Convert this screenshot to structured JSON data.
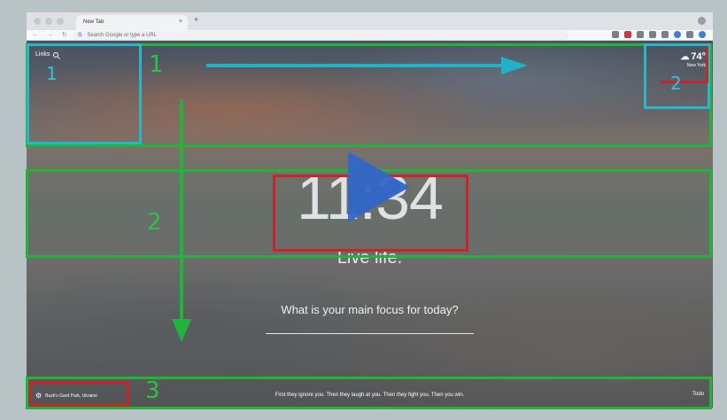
{
  "browser": {
    "tab_title": "New Tab",
    "tab_close": "×",
    "new_tab": "+",
    "omnibox_placeholder": "Search Google or type a URL",
    "omnibox_g": "G"
  },
  "momentum": {
    "links_label": "Links",
    "weather_temp": "74°",
    "weather_city": "New York",
    "clock": "11:34",
    "greeting": "Live life.",
    "focus_question": "What is your main focus for today?",
    "location": "Buzk's Gard Park, Ukraine",
    "quote": "First they ignore you. Then they laugh at you. Then they fight you. Then you win.",
    "todo": "Todo"
  },
  "annotations": {
    "labels": [
      "1",
      "1",
      "2",
      "2",
      "3"
    ],
    "colors": {
      "green": "#21b33a",
      "teal": "#29b6c7",
      "red": "#c4262e",
      "play": "#3166c9"
    }
  },
  "icons": [
    "search-icon",
    "weather-cloud-icon",
    "settings-gear-icon",
    "play-icon",
    "arrow-right-icon",
    "arrow-down-icon"
  ]
}
